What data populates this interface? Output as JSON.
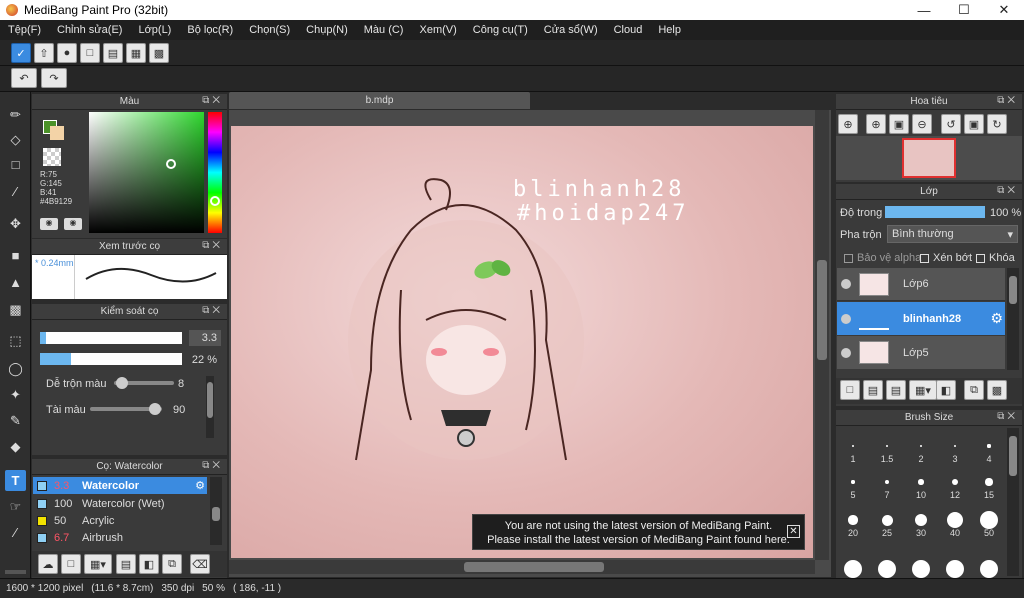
{
  "window": {
    "title": "MediBang Paint Pro (32bit)"
  },
  "menu": [
    "Tệp(F)",
    "Chỉnh sửa(E)",
    "Lớp(L)",
    "Bộ lọc(R)",
    "Chọn(S)",
    "Chụp(N)",
    "Màu (C)",
    "Xem(V)",
    "Công cụ(T)",
    "Cửa sổ(W)",
    "Cloud",
    "Help"
  ],
  "document": {
    "tab": "b.mdp"
  },
  "color_panel": {
    "title": "Màu",
    "r": "R:75",
    "g": "G:145",
    "b": "B:41",
    "hex": "#4B9129",
    "fg_color": "#4B9129",
    "bg_color": "#f3d3a7"
  },
  "brush_preview": {
    "title": "Xem trước cọ",
    "size": "0.24mm"
  },
  "brush_control": {
    "title": "Kiểm soát cọ",
    "size_value": "3.3",
    "opacity_value": "22 %",
    "size_fill": 0.03,
    "opacity_fill": 0.22,
    "blend_label": "Dễ trộn màu",
    "blend_value": "8",
    "blend_fill": 0.08,
    "resource_label": "Tài màu",
    "resource_value": "90",
    "resource_fill": 0.9
  },
  "brush_list": {
    "title": "Cọ: Watercolor",
    "items": [
      {
        "size": "3.3",
        "name": "Watercolor",
        "color": "#8fd0f4",
        "selected": true
      },
      {
        "size": "100",
        "name": "Watercolor (Wet)",
        "color": "#8fd0f4",
        "selected": false
      },
      {
        "size": "50",
        "name": "Acrylic",
        "color": "#f2e200",
        "selected": false
      },
      {
        "size": "6.7",
        "name": "Airbrush",
        "color": "#8fd0f4",
        "selected": false
      }
    ]
  },
  "navigator": {
    "title": "Hoa tiêu"
  },
  "layer_panel": {
    "title": "Lớp",
    "opacity_label": "Độ trong",
    "opacity_value": "100 %",
    "opacity_fill": 1.0,
    "blend_label": "Pha trộn",
    "blend_value": "Bình thường",
    "protect_alpha": "Bảo vệ alpha",
    "clipping": "Xén bớt",
    "lock": "Khóa",
    "layers": [
      {
        "name": "Lớp6",
        "selected": false
      },
      {
        "name": "blinhanh28",
        "selected": true
      },
      {
        "name": "Lớp5",
        "selected": false
      }
    ]
  },
  "brush_size": {
    "title": "Brush Size",
    "sizes": [
      "1",
      "1.5",
      "2",
      "3",
      "4",
      "5",
      "7",
      "10",
      "12",
      "15",
      "20",
      "25",
      "30",
      "40",
      "50"
    ]
  },
  "canvas_text": {
    "line1": "blinhanh28",
    "line2": "#hoidap247"
  },
  "notification": {
    "line1": "You are not using the latest version of MediBang Paint.",
    "line2": "Please install the latest version of MediBang Paint found here."
  },
  "status": {
    "pixels": "1600 * 1200 pixel",
    "cm": "(11.6 * 8.7cm)",
    "dpi": "350 dpi",
    "zoom": "50 %",
    "coords": "( 186, -11 )"
  }
}
